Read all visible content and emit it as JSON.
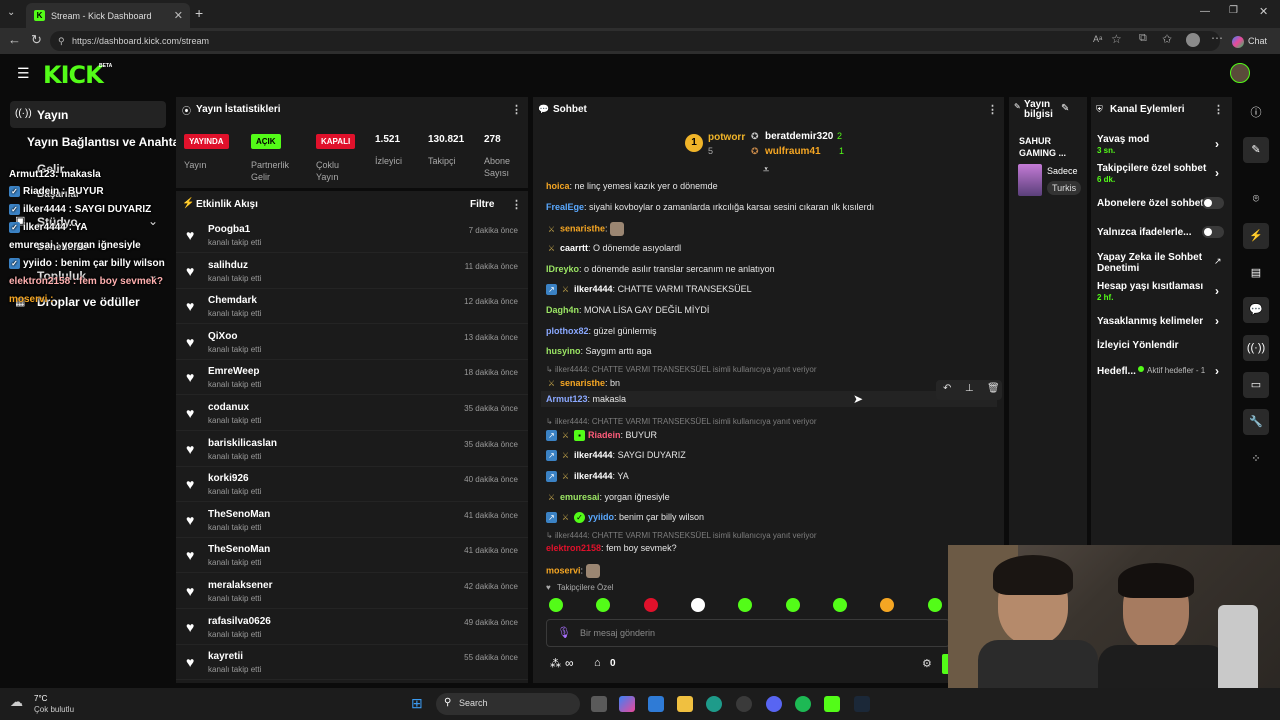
{
  "browser": {
    "tab_title": "Stream - Kick Dashboard",
    "url": "https://dashboard.kick.com/stream",
    "chat_label": "Chat"
  },
  "app": {
    "logo": "KICK",
    "beta": "BETA"
  },
  "sidebar": {
    "items": [
      {
        "label": "Yayın"
      },
      {
        "label": "Yayın Bağlantısı ve Anahtarı"
      },
      {
        "label": "Gelir"
      },
      {
        "label": "Başarılar"
      },
      {
        "label": "Stüdyo"
      },
      {
        "label": "Denetleme"
      },
      {
        "label": "Topluluk"
      },
      {
        "label": "Droplar ve ödüller"
      }
    ],
    "overlay_chat": [
      {
        "text": "Armut123: makasla"
      },
      {
        "text": "Riadein : BUYUR"
      },
      {
        "text": "ilker4444 : SAYGI DUYARIZ"
      },
      {
        "text": "ilker4444 : YA"
      },
      {
        "text": "emuresai : yorgan iğnesiyle"
      },
      {
        "text": "yyiido : benim çar billy wilson"
      },
      {
        "text": "elektron2158 : fem boy sevmek?"
      },
      {
        "text": "moservi :"
      }
    ]
  },
  "stats": {
    "title": "Yayın İstatistikleri",
    "badges": [
      {
        "badge": "YAYINDA",
        "label": "Yayın",
        "color": "#e0112b"
      },
      {
        "badge": "AÇIK",
        "label": "Partnerlik Gelir",
        "color": "#53fc18"
      },
      {
        "badge": "KAPALI",
        "label": "Çoklu Yayın",
        "color": "#e0112b"
      }
    ],
    "numbers": [
      {
        "value": "1.521",
        "label": "İzleyici"
      },
      {
        "value": "130.821",
        "label": "Takipçi"
      },
      {
        "value": "278",
        "label": "Abone Sayısı"
      }
    ]
  },
  "activity": {
    "title": "Etkinlik Akışı",
    "filter": "Filtre",
    "rows": [
      {
        "name": "Poogba1",
        "sub": "kanalı takip etti",
        "time": "7 dakika önce"
      },
      {
        "name": "salihduz",
        "sub": "kanalı takip etti",
        "time": "11 dakika önce"
      },
      {
        "name": "Chemdark",
        "sub": "kanalı takip etti",
        "time": "12 dakika önce"
      },
      {
        "name": "QiXoo",
        "sub": "kanalı takip etti",
        "time": "13 dakika önce"
      },
      {
        "name": "EmreWeep",
        "sub": "kanalı takip etti",
        "time": "18 dakika önce"
      },
      {
        "name": "codanux",
        "sub": "kanalı takip etti",
        "time": "35 dakika önce"
      },
      {
        "name": "bariskilicaslan",
        "sub": "kanalı takip etti",
        "time": "35 dakika önce"
      },
      {
        "name": "korki926",
        "sub": "kanalı takip etti",
        "time": "40 dakika önce"
      },
      {
        "name": "TheSenoMan",
        "sub": "kanalı takip etti",
        "time": "41 dakika önce"
      },
      {
        "name": "TheSenoMan",
        "sub": "kanalı takip etti",
        "time": "41 dakika önce"
      },
      {
        "name": "meralaksener",
        "sub": "kanalı takip etti",
        "time": "42 dakika önce"
      },
      {
        "name": "rafasilva0626",
        "sub": "kanalı takip etti",
        "time": "49 dakika önce"
      },
      {
        "name": "kayretii",
        "sub": "kanalı takip etti",
        "time": "55 dakika önce"
      }
    ]
  },
  "chat": {
    "title": "Sohbet",
    "leaders": {
      "top_rank": "1",
      "top_name": "potworr",
      "top_count": "5",
      "second_name": "beratdemir320",
      "second_count": "2",
      "third_name": "wulfraum41",
      "third_count": "1"
    },
    "messages": [
      {
        "user": "hoica",
        "color": "#f5a623",
        "text": "ne linç yemesi kazık yer o dönemde"
      },
      {
        "user": "FrealEge",
        "color": "#5aa9ff",
        "text": "siyahi kovboylar o zamanlarda ırkcılığa karsaı sesini cıkaran ılk kısılerdı"
      },
      {
        "user": "senaristhe",
        "color": "#f5a623",
        "text": ""
      },
      {
        "user": "caarrtt",
        "color": "#ffffff",
        "text": "O dönemde asıyolardl"
      },
      {
        "user": "IDreyko",
        "color": "#9be564",
        "text": "o dönemde asılır translar sercanım ne anlatıyon"
      },
      {
        "user": "ilker4444",
        "color": "#ffffff",
        "text": "CHATTE VARMI TRANSEKSÜEL"
      },
      {
        "user": "Dagh4n",
        "color": "#9be564",
        "text": "MONA LİSA GAY DEĞİL MİYDİ"
      },
      {
        "user": "plothox82",
        "color": "#8aa8ff",
        "text": "güzel günlermiş"
      },
      {
        "user": "husyino",
        "color": "#9be564",
        "text": "Saygım arttı aga"
      },
      {
        "user": "senaristhe",
        "color": "#f5a623",
        "text": "bn",
        "reply": "ilker4444: CHATTE VARMI TRANSEKSÜEL isimli kullanıcıya yanıt veriyor"
      },
      {
        "user": "Armut123",
        "color": "#8aa8ff",
        "text": "makasla"
      },
      {
        "user": "Riadein",
        "color": "#ff5c7a",
        "text": "BUYUR",
        "reply": "ilker4444: CHATTE VARMI TRANSEKSÜEL isimli kullanıcıya yanıt veriyor"
      },
      {
        "user": "ilker4444",
        "color": "#ffffff",
        "text": "SAYGI DUYARIZ"
      },
      {
        "user": "ilker4444",
        "color": "#ffffff",
        "text": "YA"
      },
      {
        "user": "emuresai",
        "color": "#9be564",
        "text": "yorgan iğnesiyle"
      },
      {
        "user": "yyiido",
        "color": "#5aa9ff",
        "text": "benim çar billy wilson"
      },
      {
        "user": "elektron2158",
        "color": "#e0112b",
        "text": "fem boy sevmek?",
        "reply": "ilker4444: CHATTE VARMI TRANSEKSÜEL isimli kullanıcıya yanıt veriyor"
      },
      {
        "user": "moservi",
        "color": "#f5a623",
        "text": ""
      }
    ],
    "followers_only": "Takipçilere Özel",
    "input_placeholder": "Bir mesaj gönderin",
    "points": "0",
    "infinity": "∞"
  },
  "stream_info": {
    "title": "Yayın bilgisi",
    "stream_name": "SAHUR GAMING ...",
    "category_short": "Sadece",
    "lang_tag": "Turkis"
  },
  "channel_actions": {
    "title": "Kanal Eylemleri",
    "items": [
      {
        "label": "Yavaş mod",
        "sub": "3 sn."
      },
      {
        "label": "Takipçilere özel sohbet",
        "sub": "6 dk."
      },
      {
        "label": "Abonelere özel sohbet",
        "sub": ""
      },
      {
        "label": "Yalnızca ifadelerle...",
        "sub": ""
      },
      {
        "label": "Yapay Zeka ile Sohbet Denetimi",
        "sub": ""
      },
      {
        "label": "Hesap yaşı kısıtlaması",
        "sub": "2 hf."
      },
      {
        "label": "Yasaklanmış kelimeler",
        "sub": ""
      },
      {
        "label": "İzleyici Yönlendir",
        "sub": ""
      },
      {
        "label": "Hedefl...",
        "sub": "Aktif hedefler - 1"
      }
    ]
  },
  "taskbar": {
    "weather_temp": "7°C",
    "weather_desc": "Çok bulutlu",
    "search": "Search"
  },
  "colors": {
    "accent": "#53fc18",
    "live_red": "#e0112b",
    "panel": "#1b1b1b",
    "bg": "#0b0b0b"
  }
}
